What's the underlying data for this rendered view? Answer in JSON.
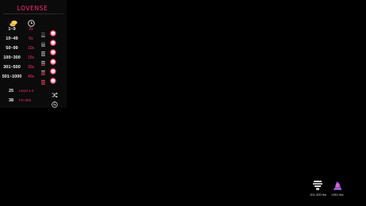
{
  "brand": {
    "logo_text": "LOVENSE",
    "accent": "#ff2d7a"
  },
  "header": {
    "token_icon": "coin-stack-icon",
    "time_icon": "clock-icon"
  },
  "levels": [
    {
      "range": "1~9",
      "duration": "2s"
    },
    {
      "range": "10~49",
      "duration": "5s"
    },
    {
      "range": "50~99",
      "duration": "10s"
    },
    {
      "range": "100~300",
      "duration": "15s"
    },
    {
      "range": "301~500",
      "duration": "30s"
    },
    {
      "range": "501~1000",
      "duration": "40s"
    }
  ],
  "specials": [
    {
      "tokens": "25",
      "label": "Level 1-4",
      "icon": "shuffle-icon"
    },
    {
      "tokens": "38",
      "label": "Fn+30s",
      "icon": "pattern-icon"
    }
  ],
  "gifts": [
    {
      "label": "101-300 tks"
    },
    {
      "label": "≥301 tks"
    }
  ]
}
